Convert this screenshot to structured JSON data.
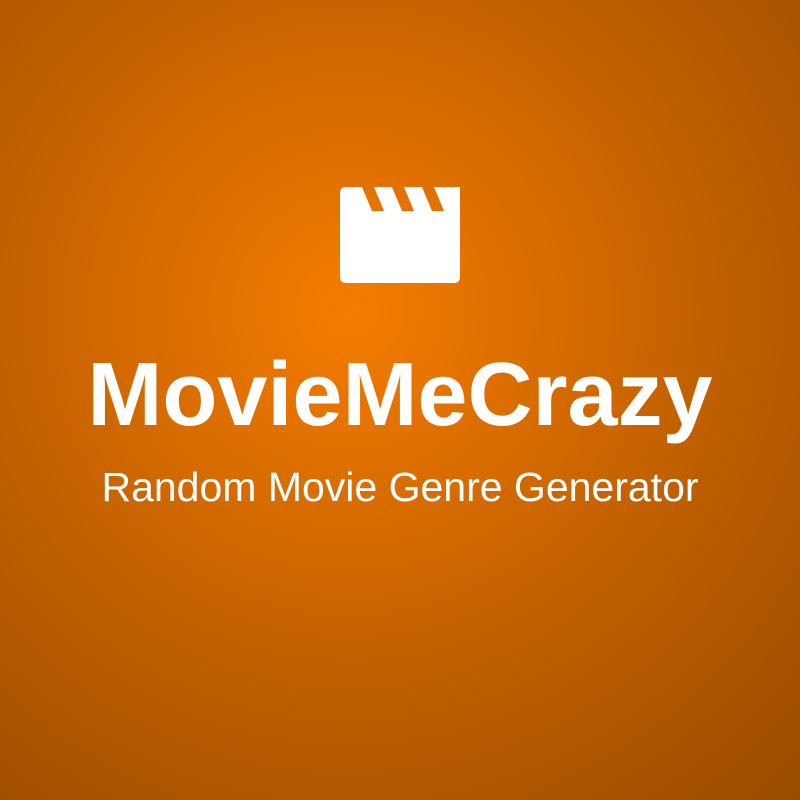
{
  "logo": {
    "icon": "clapperboard-icon"
  },
  "title": "MovieMeCrazy",
  "subtitle": "Random Movie Genre Generator",
  "colors": {
    "background_center": "#f57c00",
    "background_edge": "#9a4b00",
    "text": "#ffffff"
  }
}
